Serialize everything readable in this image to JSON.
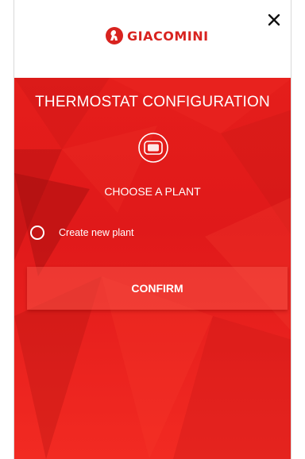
{
  "header": {
    "brand": "GIACOMINI",
    "close_icon": "close-icon"
  },
  "main": {
    "title": "THERMOSTAT CONFIGURATION",
    "device_icon": "thermostat-icon",
    "subtitle": "CHOOSE A PLANT",
    "options": [
      {
        "label": "Create new plant",
        "selected": false
      }
    ],
    "confirm_label": "CONFIRM"
  },
  "colors": {
    "brand_red": "#d8231f",
    "background_red": "#e51e1b",
    "text": "#ffffff"
  }
}
